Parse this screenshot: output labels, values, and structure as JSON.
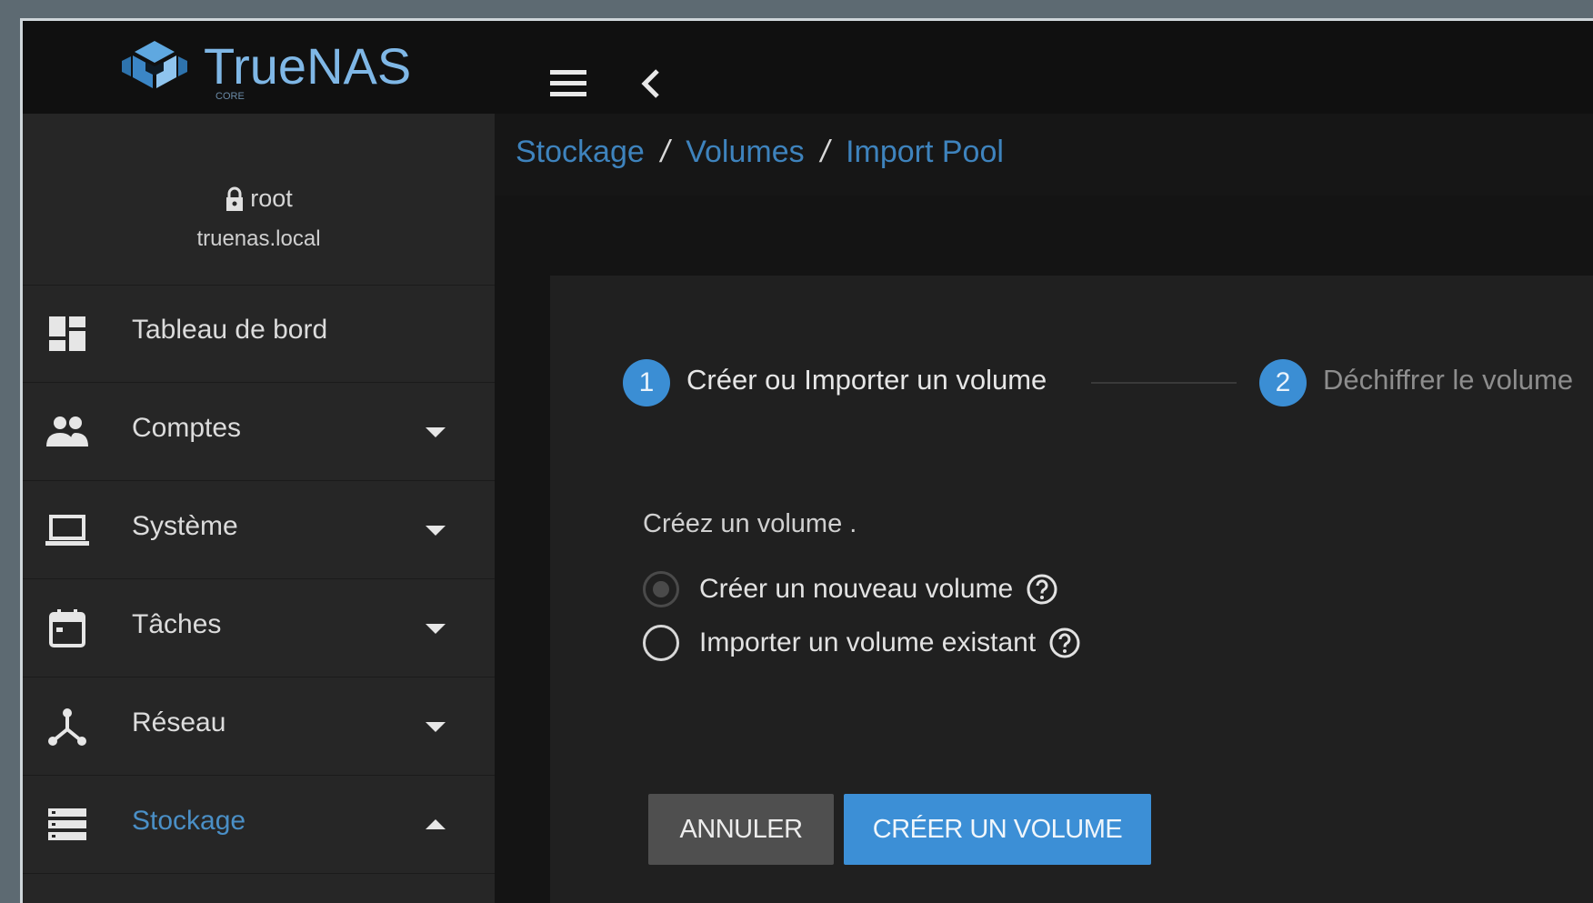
{
  "app": {
    "logo_text": "TrueNAS",
    "logo_sub": "CORE"
  },
  "user": {
    "name": "root",
    "host": "truenas.local"
  },
  "sidebar": {
    "items": [
      {
        "label": "Tableau de bord",
        "icon": "dashboard-icon",
        "caret": "none"
      },
      {
        "label": "Comptes",
        "icon": "people-icon",
        "caret": "down"
      },
      {
        "label": "Système",
        "icon": "laptop-icon",
        "caret": "down"
      },
      {
        "label": "Tâches",
        "icon": "calendar-icon",
        "caret": "down"
      },
      {
        "label": "Réseau",
        "icon": "network-icon",
        "caret": "down"
      },
      {
        "label": "Stockage",
        "icon": "storage-icon",
        "caret": "up",
        "active": true
      }
    ]
  },
  "breadcrumb": {
    "items": [
      "Stockage",
      "Volumes",
      "Import Pool"
    ],
    "separator": "/"
  },
  "stepper": {
    "steps": [
      {
        "number": "1",
        "label": "Créer ou Importer un volume",
        "active": true
      },
      {
        "number": "2",
        "label": "Déchiffrer le volume",
        "active": false
      }
    ]
  },
  "form": {
    "section_label": "Créez un volume .",
    "options": [
      {
        "label": "Créer un nouveau volume",
        "checked": true
      },
      {
        "label": "Importer un volume existant",
        "checked": false
      }
    ]
  },
  "actions": {
    "cancel_label": "ANNULER",
    "create_label": "CRÉER UN VOLUME"
  },
  "colors": {
    "accent": "#3c8fd6",
    "breadcrumb": "#3e83bd",
    "sidebar_bg": "#262626",
    "topbar_bg": "#101010"
  }
}
